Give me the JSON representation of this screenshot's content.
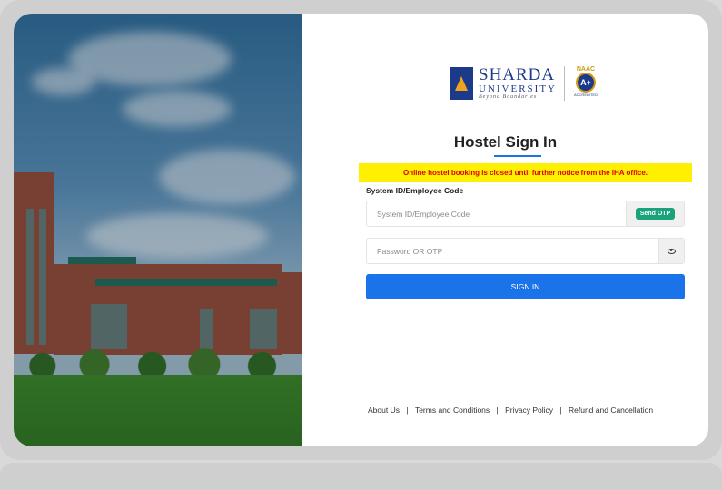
{
  "brand": {
    "name": "SHARDA",
    "sub": "UNIVERSITY",
    "tagline": "Beyond Boundaries",
    "naac_label": "NAAC",
    "naac_grade": "A+",
    "naac_caption": "ACCREDITED"
  },
  "page": {
    "title": "Hostel Sign In"
  },
  "alert": {
    "text": "Online hostel booking is closed until further notice from the IHA office.",
    "bg_color": "#ffef00",
    "text_color": "#e00000"
  },
  "form": {
    "id_label": "System ID/Employee Code",
    "id_placeholder": "System ID/Employee Code",
    "send_otp_label": "Send OTP",
    "password_placeholder": "Password OR OTP",
    "password_toggle_icon": "eye-icon",
    "signin_label": "SIGN IN",
    "accent_color": "#1a73e8",
    "otp_color": "#1aa37a"
  },
  "footer": {
    "links": [
      "About Us",
      "Terms and Conditions",
      "Privacy Policy",
      "Refund and Cancellation"
    ],
    "separator": "|"
  }
}
